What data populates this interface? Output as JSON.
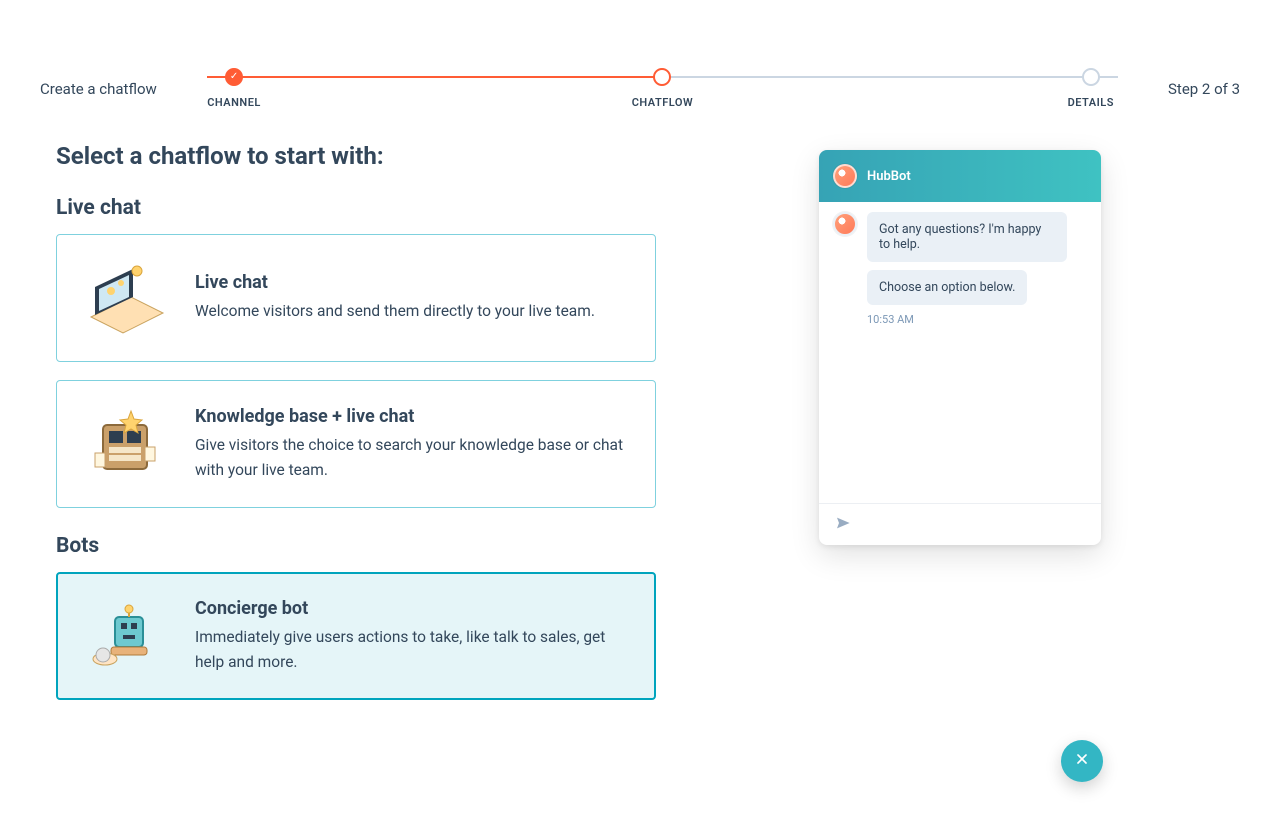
{
  "header": {
    "title": "Create a chatflow",
    "step_text": "Step 2 of 3"
  },
  "steps": {
    "s1": "CHANNEL",
    "s2": "CHATFLOW",
    "s3": "DETAILS"
  },
  "main": {
    "heading": "Select a chatflow to start with:"
  },
  "group_livechat": {
    "title": "Live chat",
    "cards": [
      {
        "title": "Live chat",
        "desc": "Welcome visitors and send them directly to your live team."
      },
      {
        "title": "Knowledge base + live chat",
        "desc": "Give visitors the choice to search your knowledge base or chat with your live team."
      }
    ]
  },
  "group_bots": {
    "title": "Bots",
    "cards": [
      {
        "title": "Concierge bot",
        "desc": "Immediately give users actions to take, like talk to sales, get help and more."
      }
    ]
  },
  "preview": {
    "bot_name": "HubBot",
    "msg1": "Got any questions? I'm happy to help.",
    "msg2": "Choose an option below.",
    "time": "10:53 AM"
  }
}
